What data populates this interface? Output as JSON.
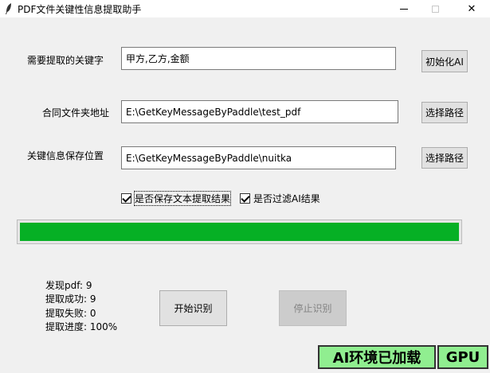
{
  "window": {
    "title": "PDF文件关键性信息提取助手",
    "icon": "feather-icon",
    "controls": {
      "minimize": "minimize-icon",
      "maximize": "maximize-icon",
      "close": "✕"
    }
  },
  "form": {
    "keywords": {
      "label": "需要提取的关键字",
      "value": "甲方,乙方,金额",
      "button": "初始化AI"
    },
    "contract_path": {
      "label": "合同文件夹地址",
      "value": "E:\\GetKeyMessageByPaddle\\test_pdf",
      "button": "选择路径"
    },
    "save_path": {
      "label": "关键信息保存位置",
      "value": "E:\\GetKeyMessageByPaddle\\nuitka",
      "button": "选择路径"
    }
  },
  "options": {
    "save_text_result": {
      "label": "是否保存文本提取结果",
      "checked": true
    },
    "filter_ai_result": {
      "label": "是否过滤AI结果",
      "checked": true
    }
  },
  "progress": {
    "percent": 100,
    "color": "#06b025"
  },
  "stats": {
    "found": "发现pdf: 9",
    "success": "提取成功: 9",
    "failed": "提取失败: 0",
    "progress": "提取进度: 100%"
  },
  "actions": {
    "start": "开始识别",
    "stop": "停止识别"
  },
  "status": {
    "ai_env": "AI环境已加载",
    "device": "GPU",
    "color": "#90ee90"
  }
}
